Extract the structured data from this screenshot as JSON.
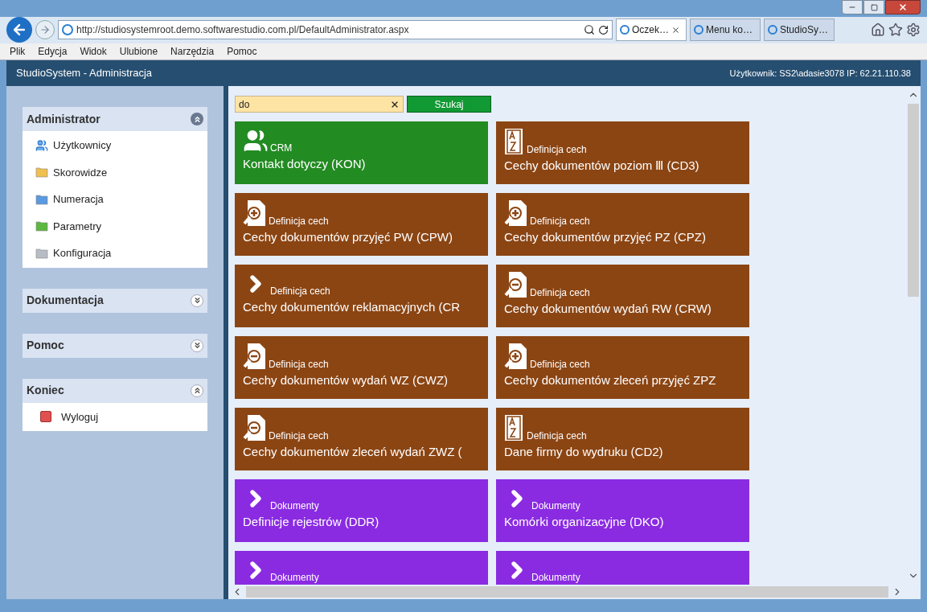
{
  "browser": {
    "address": "http://studiosystemroot.demo.softwarestudio.com.pl/DefaultAdministrator.aspx",
    "tabs": [
      {
        "label": "Oczek…",
        "selected": true
      },
      {
        "label": "Menu ko…",
        "selected": false
      },
      {
        "label": "StudioSy…",
        "selected": false
      }
    ],
    "menu": [
      "Plik",
      "Edycja",
      "Widok",
      "Ulubione",
      "Narzędzia",
      "Pomoc"
    ]
  },
  "header": {
    "title": "StudioSystem - Administracja",
    "user": "Użytkownik: SS2\\adasie3078 IP: 62.21.110.38"
  },
  "sidebar": [
    {
      "title": "Administrator",
      "expanded": true,
      "items": [
        {
          "label": "Użytkownicy",
          "kind": "users"
        },
        {
          "label": "Skorowidze",
          "kind": "folder",
          "color": "#f0c050"
        },
        {
          "label": "Numeracja",
          "kind": "folder",
          "color": "#5a9ae0"
        },
        {
          "label": "Parametry",
          "kind": "folder",
          "color": "#5cb840"
        },
        {
          "label": "Konfiguracja",
          "kind": "folder",
          "color": "#b8bcc4"
        }
      ]
    },
    {
      "title": "Dokumentacja",
      "expanded": false
    },
    {
      "title": "Pomoc",
      "expanded": false
    },
    {
      "title": "Koniec",
      "expanded": true,
      "items": [
        {
          "label": "Wyloguj",
          "kind": "logout"
        }
      ]
    }
  ],
  "search": {
    "value": "do",
    "button": "Szukaj"
  },
  "tiles": [
    {
      "category": "CRM",
      "title": "Kontakt dotyczy (KON)",
      "color": "#228b22",
      "kind": "people"
    },
    {
      "category": "Definicja cech",
      "title": "Cechy dokumentów poziom Ⅲ (CD3)",
      "color": "#8b4513",
      "kind": "az"
    },
    {
      "category": "Definicja cech",
      "title": "Cechy dokumentów przyjęć PW (CPW)",
      "color": "#8b4513",
      "kind": "plus"
    },
    {
      "category": "Definicja cech",
      "title": "Cechy dokumentów przyjęć PZ (CPZ)",
      "color": "#8b4513",
      "kind": "plus"
    },
    {
      "category": "Definicja cech",
      "title": "Cechy dokumentów reklamacyjnych (CR",
      "color": "#8b4513",
      "kind": "chevron"
    },
    {
      "category": "Definicja cech",
      "title": "Cechy dokumentów wydań RW (CRW)",
      "color": "#8b4513",
      "kind": "minus"
    },
    {
      "category": "Definicja cech",
      "title": "Cechy dokumentów wydań WZ (CWZ)",
      "color": "#8b4513",
      "kind": "minus"
    },
    {
      "category": "Definicja cech",
      "title": "Cechy dokumentów zleceń przyjęć ZPZ",
      "color": "#8b4513",
      "kind": "plus"
    },
    {
      "category": "Definicja cech",
      "title": "Cechy dokumentów zleceń wydań ZWZ (",
      "color": "#8b4513",
      "kind": "minus"
    },
    {
      "category": "Definicja cech",
      "title": "Dane firmy do wydruku (CD2)",
      "color": "#8b4513",
      "kind": "az"
    },
    {
      "category": "Dokumenty",
      "title": "Definicje rejestrów (DDR)",
      "color": "#8a2be2",
      "kind": "chevron"
    },
    {
      "category": "Dokumenty",
      "title": "Komórki organizacyjne (DKO)",
      "color": "#8a2be2",
      "kind": "chevron"
    },
    {
      "category": "Dokumenty",
      "color": "#8a2be2",
      "kind": "chevron"
    },
    {
      "category": "Dokumenty",
      "color": "#8a2be2",
      "kind": "chevron"
    }
  ]
}
